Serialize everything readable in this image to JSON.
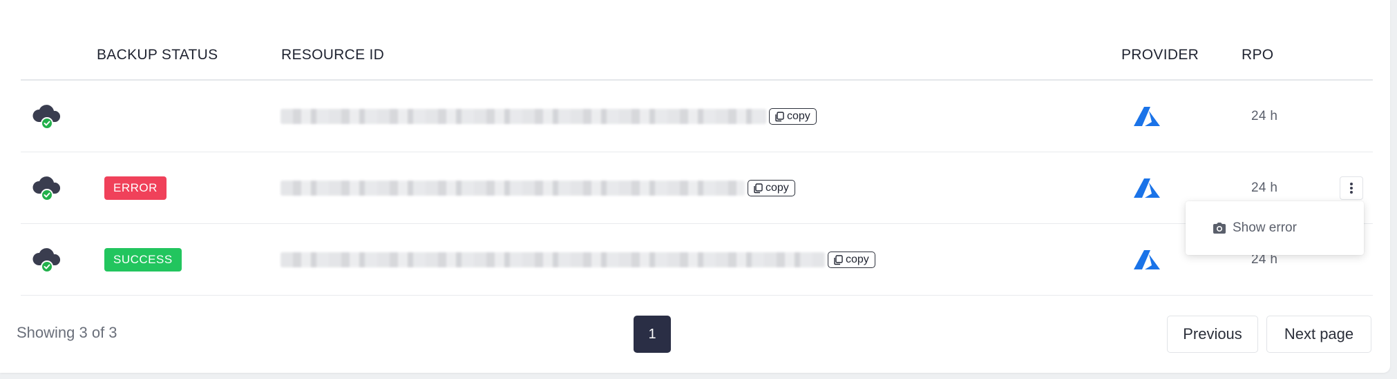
{
  "table": {
    "headers": {
      "backup_status": "BACKUP STATUS",
      "resource_id": "RESOURCE ID",
      "provider": "PROVIDER",
      "rpo": "RPO"
    },
    "rows": [
      {
        "status": "",
        "status_color": "",
        "copy_label": "copy",
        "provider": "azure-icon",
        "rpo": "24 h"
      },
      {
        "status": "ERROR",
        "status_color": "#f0415a",
        "copy_label": "copy",
        "provider": "azure-icon",
        "rpo": "24 h"
      },
      {
        "status": "SUCCESS",
        "status_color": "#22c55e",
        "copy_label": "copy",
        "provider": "azure-icon",
        "rpo": "24 h"
      }
    ]
  },
  "dropdown": {
    "item_label": "Show error",
    "item_icon": "camera-icon"
  },
  "footer": {
    "showing": "Showing 3 of 3",
    "current_page": "1",
    "previous_label": "Previous",
    "next_label": "Next page"
  },
  "colors": {
    "azure_blue": "#1a73e8",
    "cloud_dark": "#3a3d4f",
    "check_green": "#22b04b",
    "page_active": "#2a2e45"
  }
}
